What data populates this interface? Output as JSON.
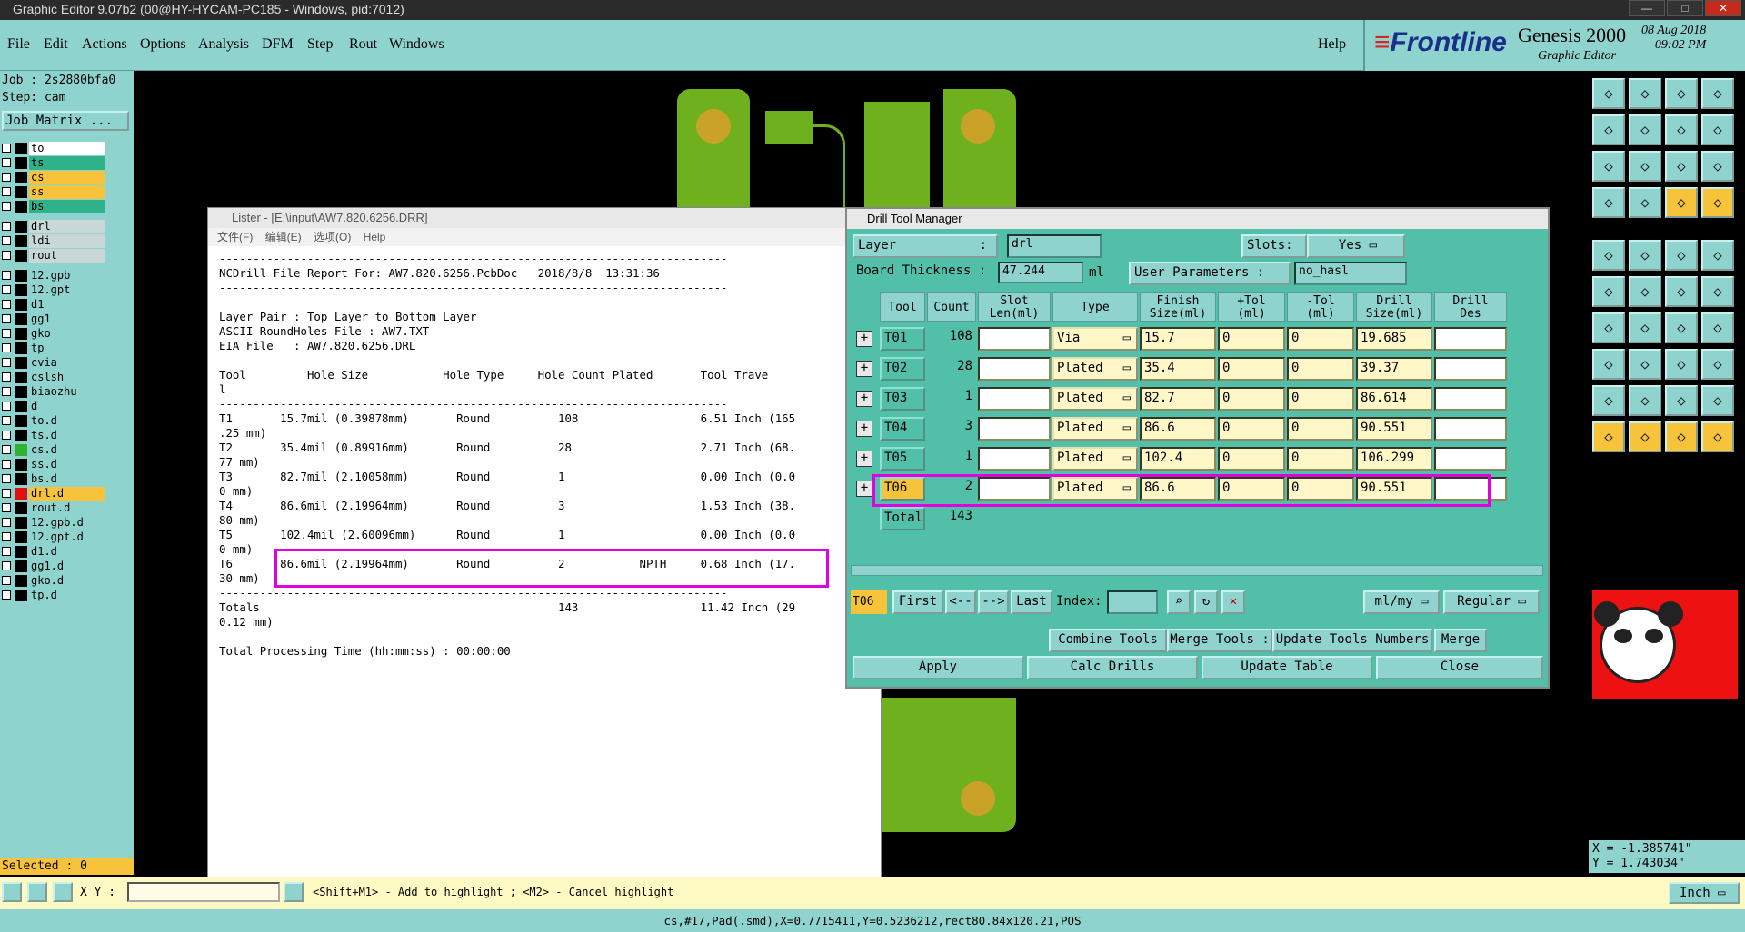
{
  "window": {
    "title": "Graphic Editor 9.07b2 (00@HY-HYCAM-PC185 - Windows, pid:7012)",
    "buttons": [
      "—",
      "□",
      "✕"
    ]
  },
  "menubar": {
    "items": [
      "File",
      "Edit",
      "Actions",
      "Options",
      "Analysis",
      "DFM",
      "Step",
      "Rout",
      "Windows"
    ],
    "help": "Help"
  },
  "brand": {
    "logo": "Frontline",
    "product": "Genesis 2000",
    "subtitle": "Graphic Editor",
    "date": "08 Aug 2018",
    "time": "09:02 PM"
  },
  "left": {
    "job": "Job : 2s2880bfa0",
    "step": "Step: cam",
    "job_matrix": "Job Matrix ...",
    "layers": [
      {
        "name": "to",
        "color": "#ffffff",
        "swatch": "#000000"
      },
      {
        "name": "ts",
        "color": "#2fb28a",
        "swatch": "#000000"
      },
      {
        "name": "cs",
        "color": "#f7c33a",
        "swatch": "#000000"
      },
      {
        "name": "ss",
        "color": "#f7c33a",
        "swatch": "#000000"
      },
      {
        "name": "bs",
        "color": "#2fb28a",
        "swatch": "#000000"
      },
      {
        "name": "drl",
        "color": "#c9d8d6",
        "swatch": "#000000"
      },
      {
        "name": "ldi",
        "color": "#c9d8d6",
        "swatch": "#000000"
      },
      {
        "name": "rout",
        "color": "#c9d8d6",
        "swatch": "#000000"
      },
      {
        "name": "12.gpb",
        "color": "#8fd3cf",
        "swatch": "#000000"
      },
      {
        "name": "12.gpt",
        "color": "#8fd3cf",
        "swatch": "#000000"
      },
      {
        "name": "d1",
        "color": "#8fd3cf",
        "swatch": "#000000"
      },
      {
        "name": "gg1",
        "color": "#8fd3cf",
        "swatch": "#000000"
      },
      {
        "name": "gko",
        "color": "#8fd3cf",
        "swatch": "#000000"
      },
      {
        "name": "tp",
        "color": "#8fd3cf",
        "swatch": "#000000"
      },
      {
        "name": "cvia",
        "color": "#8fd3cf",
        "swatch": "#000000"
      },
      {
        "name": "cslsh",
        "color": "#8fd3cf",
        "swatch": "#000000"
      },
      {
        "name": "biaozhu",
        "color": "#8fd3cf",
        "swatch": "#000000"
      },
      {
        "name": "d",
        "color": "#8fd3cf",
        "swatch": "#000000"
      },
      {
        "name": "to.d",
        "color": "#8fd3cf",
        "swatch": "#000000"
      },
      {
        "name": "ts.d",
        "color": "#8fd3cf",
        "swatch": "#000000"
      },
      {
        "name": "cs.d",
        "color": "#8fd3cf",
        "swatch": "#2fb22f"
      },
      {
        "name": "ss.d",
        "color": "#8fd3cf",
        "swatch": "#000000"
      },
      {
        "name": "bs.d",
        "color": "#8fd3cf",
        "swatch": "#000000"
      },
      {
        "name": "drl.d",
        "color": "#f7c33a",
        "swatch": "#e01010"
      },
      {
        "name": "rout.d",
        "color": "#8fd3cf",
        "swatch": "#000000"
      },
      {
        "name": "12.gpb.d",
        "color": "#8fd3cf",
        "swatch": "#000000"
      },
      {
        "name": "12.gpt.d",
        "color": "#8fd3cf",
        "swatch": "#000000"
      },
      {
        "name": "d1.d",
        "color": "#8fd3cf",
        "swatch": "#000000"
      },
      {
        "name": "gg1.d",
        "color": "#8fd3cf",
        "swatch": "#000000"
      },
      {
        "name": "gko.d",
        "color": "#8fd3cf",
        "swatch": "#000000"
      },
      {
        "name": "tp.d",
        "color": "#8fd3cf",
        "swatch": "#000000"
      }
    ],
    "selected": "Selected : 0"
  },
  "lister": {
    "title": "Lister - [E:\\input\\AW7.820.6256.DRR]",
    "menu": "文件(F) 编辑(E) 选项(O) Help",
    "text": "---------------------------------------------------------------------------\nNCDrill File Report For: AW7.820.6256.PcbDoc   2018/8/8  13:31:36\n---------------------------------------------------------------------------\n\nLayer Pair : Top Layer to Bottom Layer\nASCII RoundHoles File : AW7.TXT\nEIA File   : AW7.820.6256.DRL\n\nTool         Hole Size           Hole Type     Hole Count Plated       Tool Trave\nl\n---------------------------------------------------------------------------\nT1       15.7mil (0.39878mm)       Round          108                  6.51 Inch (165\n.25 mm)\nT2       35.4mil (0.89916mm)       Round          28                   2.71 Inch (68.\n77 mm)\nT3       82.7mil (2.10058mm)       Round          1                    0.00 Inch (0.0\n0 mm)\nT4       86.6mil (2.19964mm)       Round          3                    1.53 Inch (38.\n80 mm)\nT5       102.4mil (2.60096mm)      Round          1                    0.00 Inch (0.0\n0 mm)\nT6       86.6mil (2.19964mm)       Round          2           NPTH     0.68 Inch (17.\n30 mm)\n---------------------------------------------------------------------------\nTotals                                            143                  11.42 Inch (29\n0.12 mm)\n\nTotal Processing Time (hh:mm:ss) : 00:00:00"
  },
  "dtm": {
    "title": "Drill Tool Manager",
    "layer_label": "Layer",
    "layer_value": "drl",
    "slots_label": "Slots:",
    "slots_value": "Yes",
    "thickness_label": "Board Thickness  :",
    "thickness_value": "47.244",
    "thickness_unit": "ml",
    "user_params_label": "User Parameters :",
    "user_params_value": "no_hasl",
    "headers": [
      "Tool",
      "Count",
      "Slot\nLen(ml)",
      "Type",
      "Finish\nSize(ml)",
      "+Tol\n(ml)",
      "-Tol\n(ml)",
      "Drill\nSize(ml)",
      "Drill\nDes"
    ],
    "rows": [
      {
        "tool": "T01",
        "count": "108",
        "type": "Via",
        "finish": "15.7",
        "ptol": "0",
        "ntol": "0",
        "drill": "19.685"
      },
      {
        "tool": "T02",
        "count": "28",
        "type": "Plated",
        "finish": "35.4",
        "ptol": "0",
        "ntol": "0",
        "drill": "39.37"
      },
      {
        "tool": "T03",
        "count": "1",
        "type": "Plated",
        "finish": "82.7",
        "ptol": "0",
        "ntol": "0",
        "drill": "86.614"
      },
      {
        "tool": "T04",
        "count": "3",
        "type": "Plated",
        "finish": "86.6",
        "ptol": "0",
        "ntol": "0",
        "drill": "90.551"
      },
      {
        "tool": "T05",
        "count": "1",
        "type": "Plated",
        "finish": "102.4",
        "ptol": "0",
        "ntol": "0",
        "drill": "106.299"
      },
      {
        "tool": "T06",
        "count": "2",
        "type": "Plated",
        "finish": "86.6",
        "ptol": "0",
        "ntol": "0",
        "drill": "90.551"
      }
    ],
    "total_label": "Total",
    "total_count": "143",
    "current_tool": "T06",
    "nav": {
      "first": "First",
      "prev": "<--",
      "next": "-->",
      "last": "Last",
      "index": "Index:"
    },
    "units": "ml/my",
    "mode": "Regular",
    "buttons": {
      "combine": "Combine Tools",
      "merge_tools": "Merge Tools :",
      "update_numbers": "Update Tools Numbers",
      "merge": "Merge",
      "apply": "Apply",
      "calc": "Calc Drills",
      "update_table": "Update Table",
      "close": "Close"
    }
  },
  "coords": {
    "x": "X = -1.385741\"",
    "y": "Y = 1.743034\""
  },
  "bottom": {
    "xy_label": "X Y :",
    "hint": "<Shift+M1> - Add to highlight ; <M2> - Cancel highlight",
    "units": "Inch"
  },
  "status": "cs,#17,Pad(.smd),X=0.7715411,Y=0.5236212,rect80.84x120.21,POS",
  "colors": {
    "teal": "#8fd3cf",
    "dtm_bg": "#52bfa9",
    "highlight": "#e000e0",
    "orange": "#f7c33a",
    "pcb_green": "#6fb01f",
    "pad": "#c9a227"
  }
}
